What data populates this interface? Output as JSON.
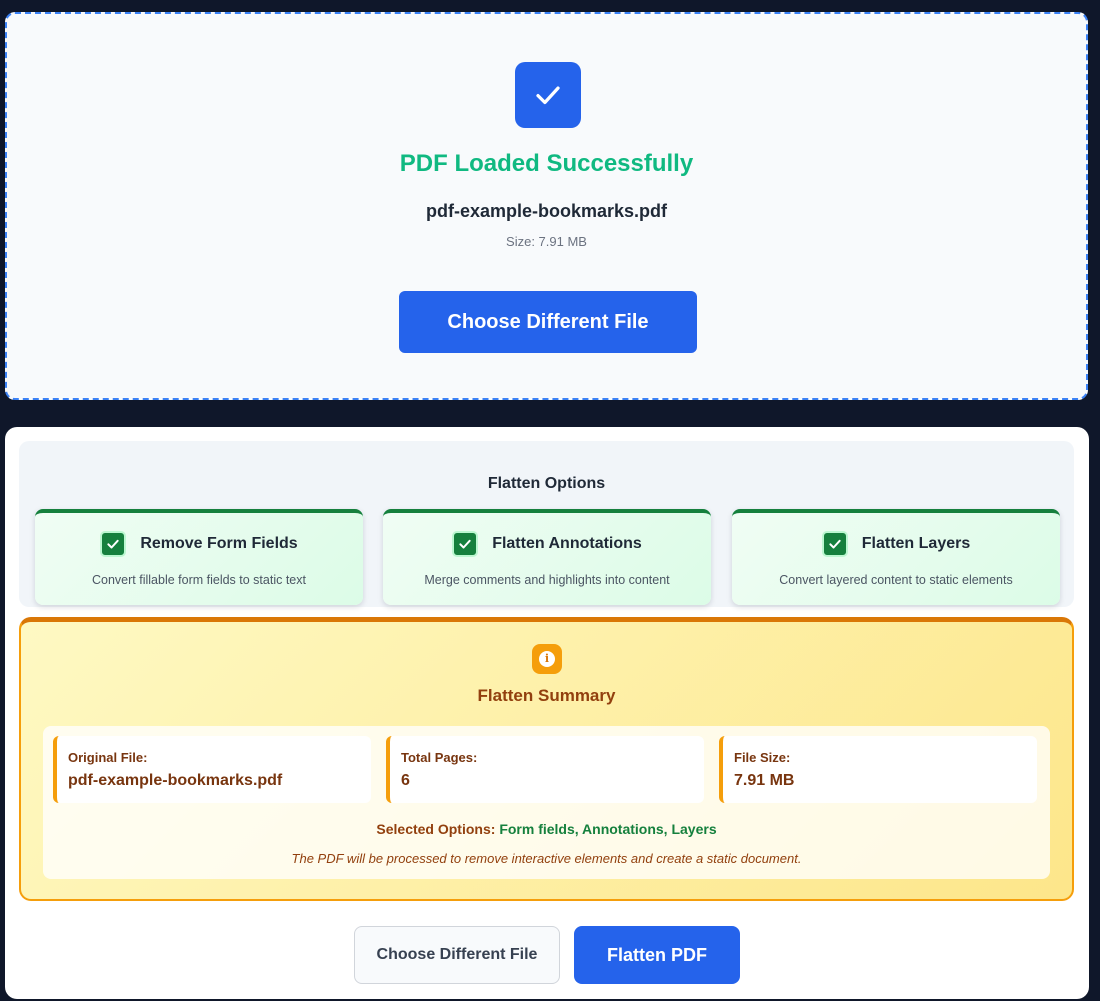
{
  "upload": {
    "status_title": "PDF Loaded Successfully",
    "file_name": "pdf-example-bookmarks.pdf",
    "file_size": "Size: 7.91 MB",
    "choose_label": "Choose Different File"
  },
  "options": {
    "title": "Flatten Options",
    "items": [
      {
        "label": "Remove Form Fields",
        "description": "Convert fillable form fields to static text",
        "checked": true
      },
      {
        "label": "Flatten Annotations",
        "description": "Merge comments and highlights into content",
        "checked": true
      },
      {
        "label": "Flatten Layers",
        "description": "Convert layered content to static elements",
        "checked": true
      }
    ]
  },
  "summary": {
    "title": "Flatten Summary",
    "stats": [
      {
        "label": "Original File:",
        "value": "pdf-example-bookmarks.pdf"
      },
      {
        "label": "Total Pages:",
        "value": "6"
      },
      {
        "label": "File Size:",
        "value": "7.91 MB"
      }
    ],
    "selected_label": "Selected Options:",
    "selected_value": "Form fields, Annotations, Layers",
    "note": "The PDF will be processed to remove interactive elements and create a static document."
  },
  "actions": {
    "choose_label": "Choose Different File",
    "flatten_label": "Flatten PDF"
  },
  "icons": {
    "success": "check-icon",
    "checkbox": "checkbox-checked-icon",
    "info": "info-icon"
  },
  "colors": {
    "primary": "#2563eb",
    "success": "#10b981",
    "check_green": "#15803d",
    "summary_accent": "#f59e0b",
    "summary_text": "#92400e",
    "page_background": "#0f172a"
  }
}
